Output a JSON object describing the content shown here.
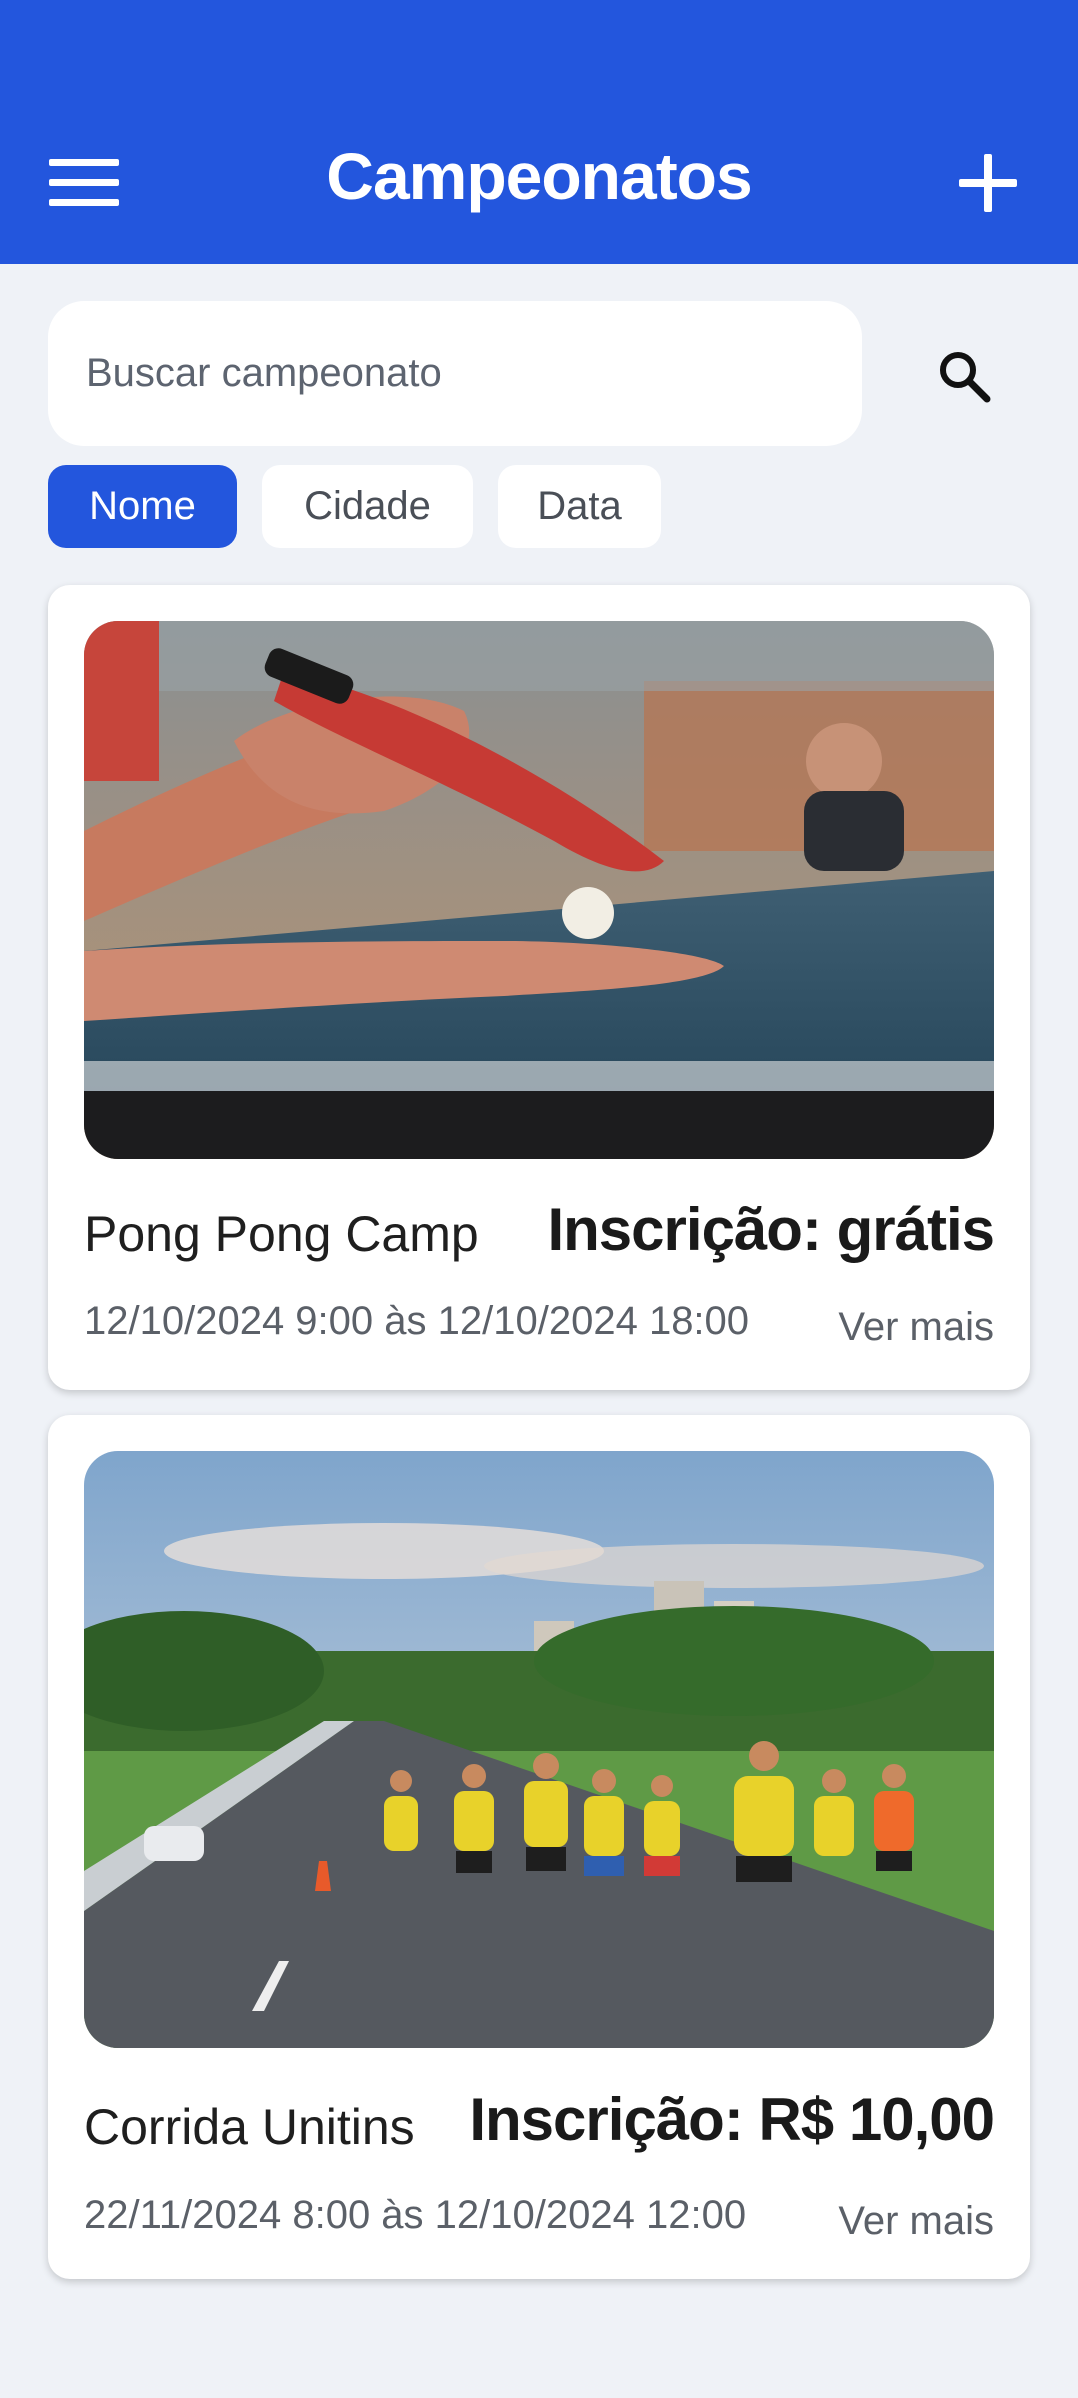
{
  "header": {
    "title": "Campeonatos",
    "background": "#2356dd",
    "menu_icon": "hamburger-menu-icon",
    "add_icon": "plus-icon"
  },
  "search": {
    "placeholder": "Buscar campeonato",
    "value": "",
    "icon": "search-icon"
  },
  "filters": [
    {
      "label": "Nome",
      "active": true
    },
    {
      "label": "Cidade",
      "active": false
    },
    {
      "label": "Data",
      "active": false
    }
  ],
  "championships": [
    {
      "name": "Pong Pong Camp",
      "price": "Inscrição: grátis",
      "dates": "12/10/2024 9:00 às 12/10/2024 18:00",
      "more": "Ver mais",
      "image": "table-tennis-photo"
    },
    {
      "name": "Corrida Unitins",
      "price": "Inscrição: R$ 10,00",
      "dates": "22/11/2024 8:00 às 12/10/2024 12:00",
      "more": "Ver mais",
      "image": "street-running-race-photo"
    }
  ]
}
